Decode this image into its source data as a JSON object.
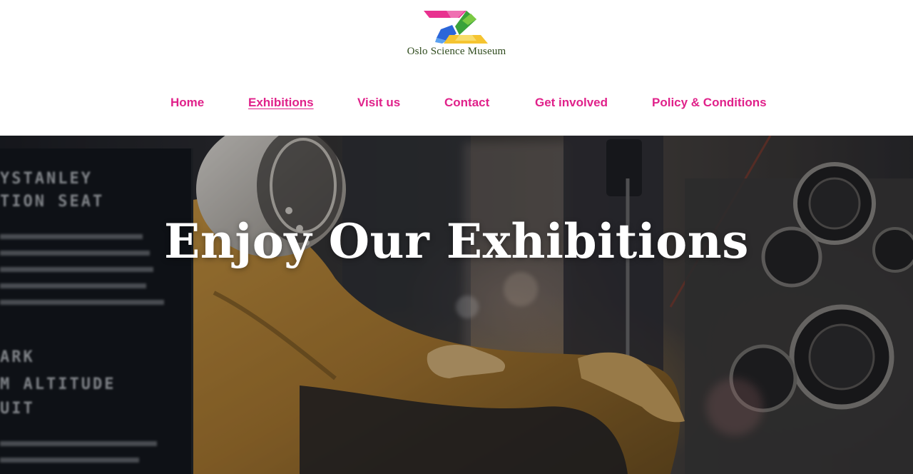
{
  "header": {
    "logo_icon": "museum-logo-mark",
    "site_name": "Oslo Science Museum",
    "nav": [
      {
        "label": "Home",
        "active": false
      },
      {
        "label": "Exhibitions",
        "active": true
      },
      {
        "label": "Visit us",
        "active": false
      },
      {
        "label": "Contact",
        "active": false
      },
      {
        "label": "Get involved",
        "active": false
      },
      {
        "label": "Policy & Conditions",
        "active": false
      }
    ]
  },
  "hero": {
    "title": "Enjoy Our Exhibitions",
    "image_subject": "pilot in yellow flight suit and helmet beside exhibit sign and instrument panels",
    "sign_text": [
      "YSTANLEY",
      "TION SEAT",
      "ARK",
      "M ALTITUDE",
      "UIT"
    ]
  },
  "colors": {
    "nav_link": "#e0218a",
    "site_name": "#2e4a1c",
    "logo_pink": "#e8318f",
    "logo_green": "#3aa23a",
    "logo_blue": "#2b66d9",
    "logo_yellow": "#f5c431",
    "hero_title": "#ffffff"
  }
}
